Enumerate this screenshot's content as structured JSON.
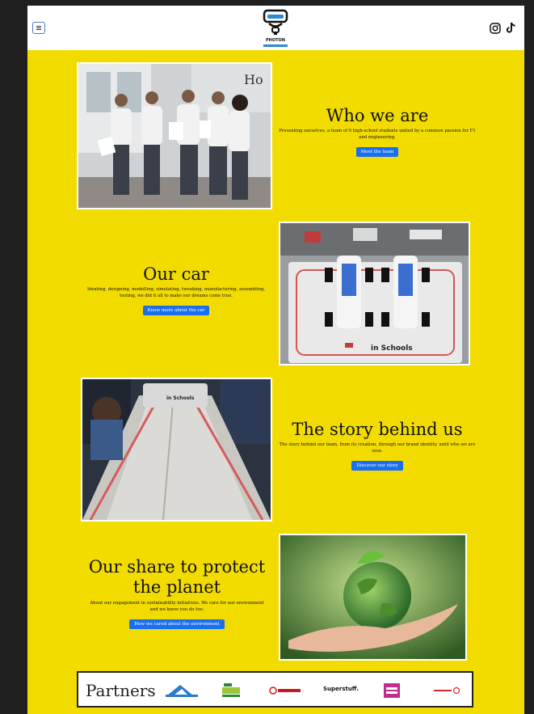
{
  "header": {
    "logo_text": "PHOTON"
  },
  "sections": [
    {
      "title": "Who we are",
      "text": "Presenting ourselves, a team of 6 high-school students united by a common passion for F1 and engineering.",
      "button": "Meet the team"
    },
    {
      "title": "Our car",
      "text": "Ideating, designing, modelling, simulating, tweaking, manufacturing, assembling, testing, we did it all to make our dreams come true.",
      "button": "Know more about the car",
      "image_text": "in Schools"
    },
    {
      "title": "The story behind us",
      "text": "The story behind our team, from its creation, through our brand identity, until who we are now.",
      "button": "Discover our story",
      "image_text": "in Schools"
    },
    {
      "title": "Our share to protect the planet",
      "text": "About our engagement in sustainability initiatives. We care for our environment and we know you do too.",
      "button": "How we cared about the environment"
    }
  ],
  "partners": {
    "title": "Partners",
    "logos": [
      "Superstuff."
    ]
  },
  "colors": {
    "background": "#f2dc00",
    "button": "#1a6ef0"
  }
}
